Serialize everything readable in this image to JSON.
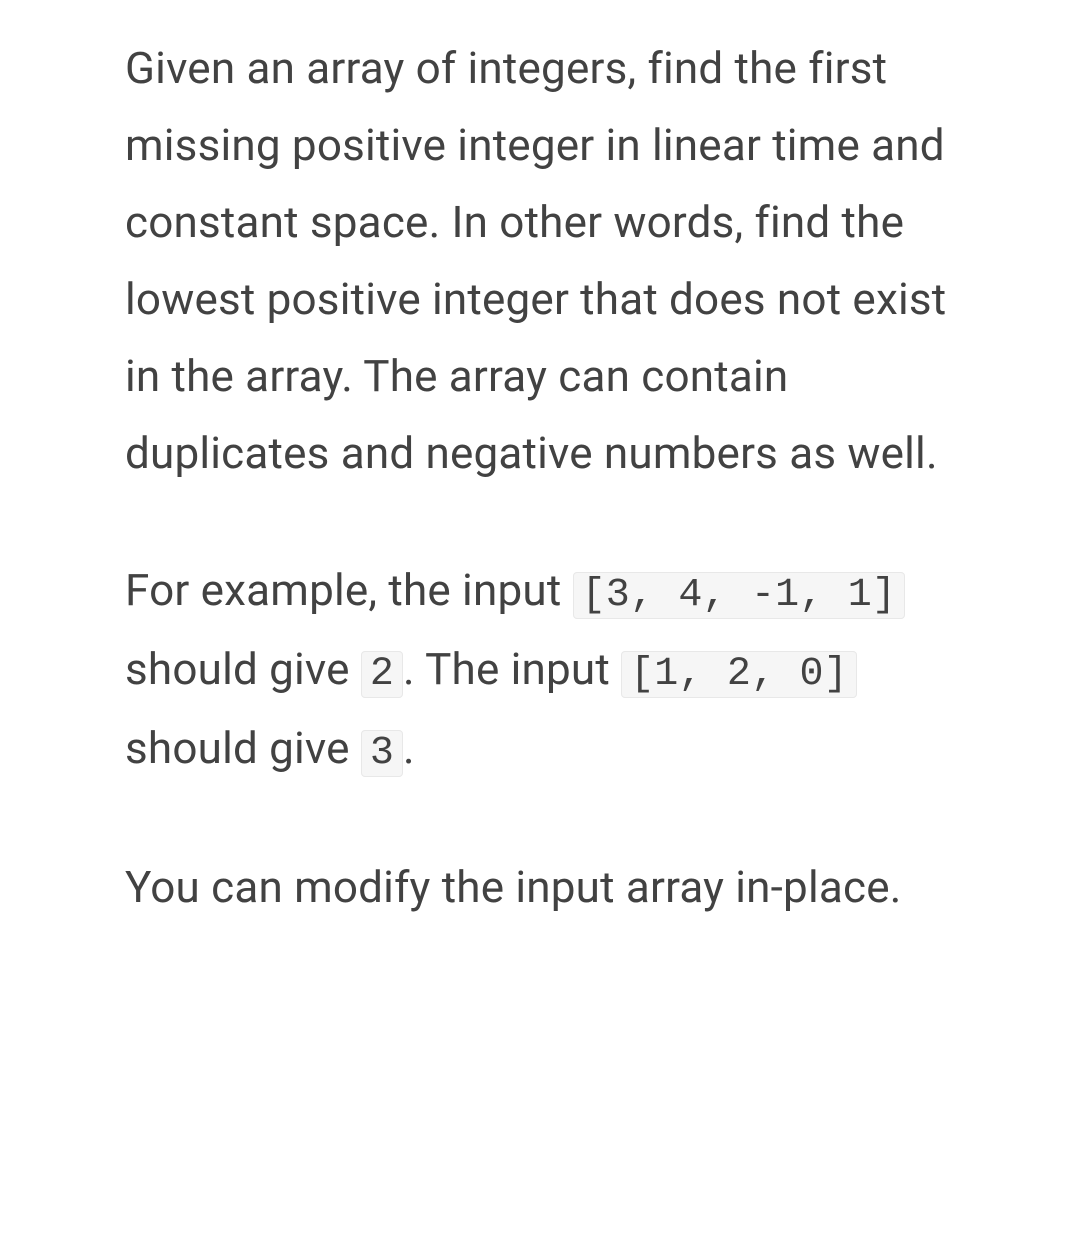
{
  "paragraphs": {
    "p1": "Given an array of integers, find the first missing positive integer in linear time and constant space. In other words, find the lowest positive integer that does not exist in the array. The array can contain duplicates and negative numbers as well.",
    "p2": {
      "t1": "For example, the input ",
      "c1": "[3, 4, -1, 1]",
      "t2": " should give ",
      "c2": "2",
      "t3": ". The input ",
      "c3": "[1, 2, 0]",
      "t4": " should give ",
      "c4": "3",
      "t5": "."
    },
    "p3": "You can modify the input array in-place."
  }
}
